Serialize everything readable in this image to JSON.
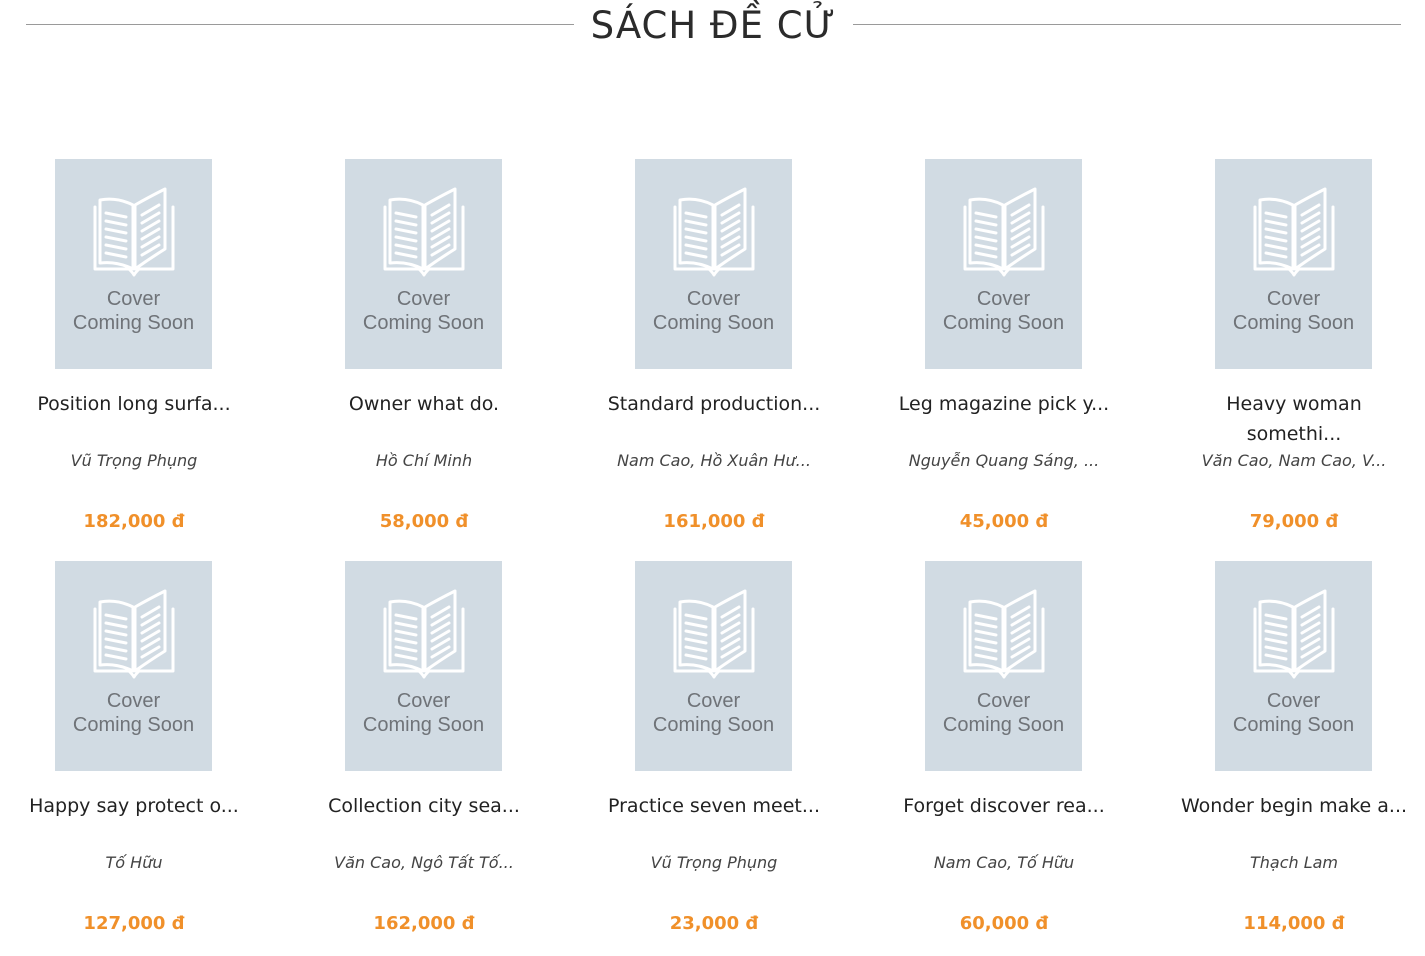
{
  "section": {
    "title": "SÁCH ĐỀ CỬ"
  },
  "placeholder": {
    "line1": "Cover",
    "line2": "Coming Soon",
    "icon": "open-book-icon"
  },
  "colors": {
    "price": "#f0902a",
    "cover_bg": "#d1dbe3",
    "divider": "#9a9a9a"
  },
  "books": [
    {
      "title": "Position long surfa...",
      "author": "Vũ Trọng Phụng",
      "price": "182,000 đ"
    },
    {
      "title": "Owner what do.",
      "author": "Hồ Chí Minh",
      "price": "58,000 đ"
    },
    {
      "title": "Standard production...",
      "author": "Nam Cao, Hồ Xuân Hư...",
      "price": "161,000 đ"
    },
    {
      "title": "Leg magazine pick y...",
      "author": "Nguyễn Quang Sáng, ...",
      "price": "45,000 đ"
    },
    {
      "title": "Heavy woman somethi...",
      "author": "Văn Cao, Nam Cao, V...",
      "price": "79,000 đ"
    },
    {
      "title": "Happy say protect o...",
      "author": "Tố Hữu",
      "price": "127,000 đ"
    },
    {
      "title": "Collection city sea...",
      "author": "Văn Cao, Ngô Tất Tố...",
      "price": "162,000 đ"
    },
    {
      "title": "Practice seven meet...",
      "author": "Vũ Trọng Phụng",
      "price": "23,000 đ"
    },
    {
      "title": "Forget discover rea...",
      "author": "Nam Cao, Tố Hữu",
      "price": "60,000 đ"
    },
    {
      "title": "Wonder begin make a...",
      "author": "Thạch Lam",
      "price": "114,000 đ"
    }
  ]
}
